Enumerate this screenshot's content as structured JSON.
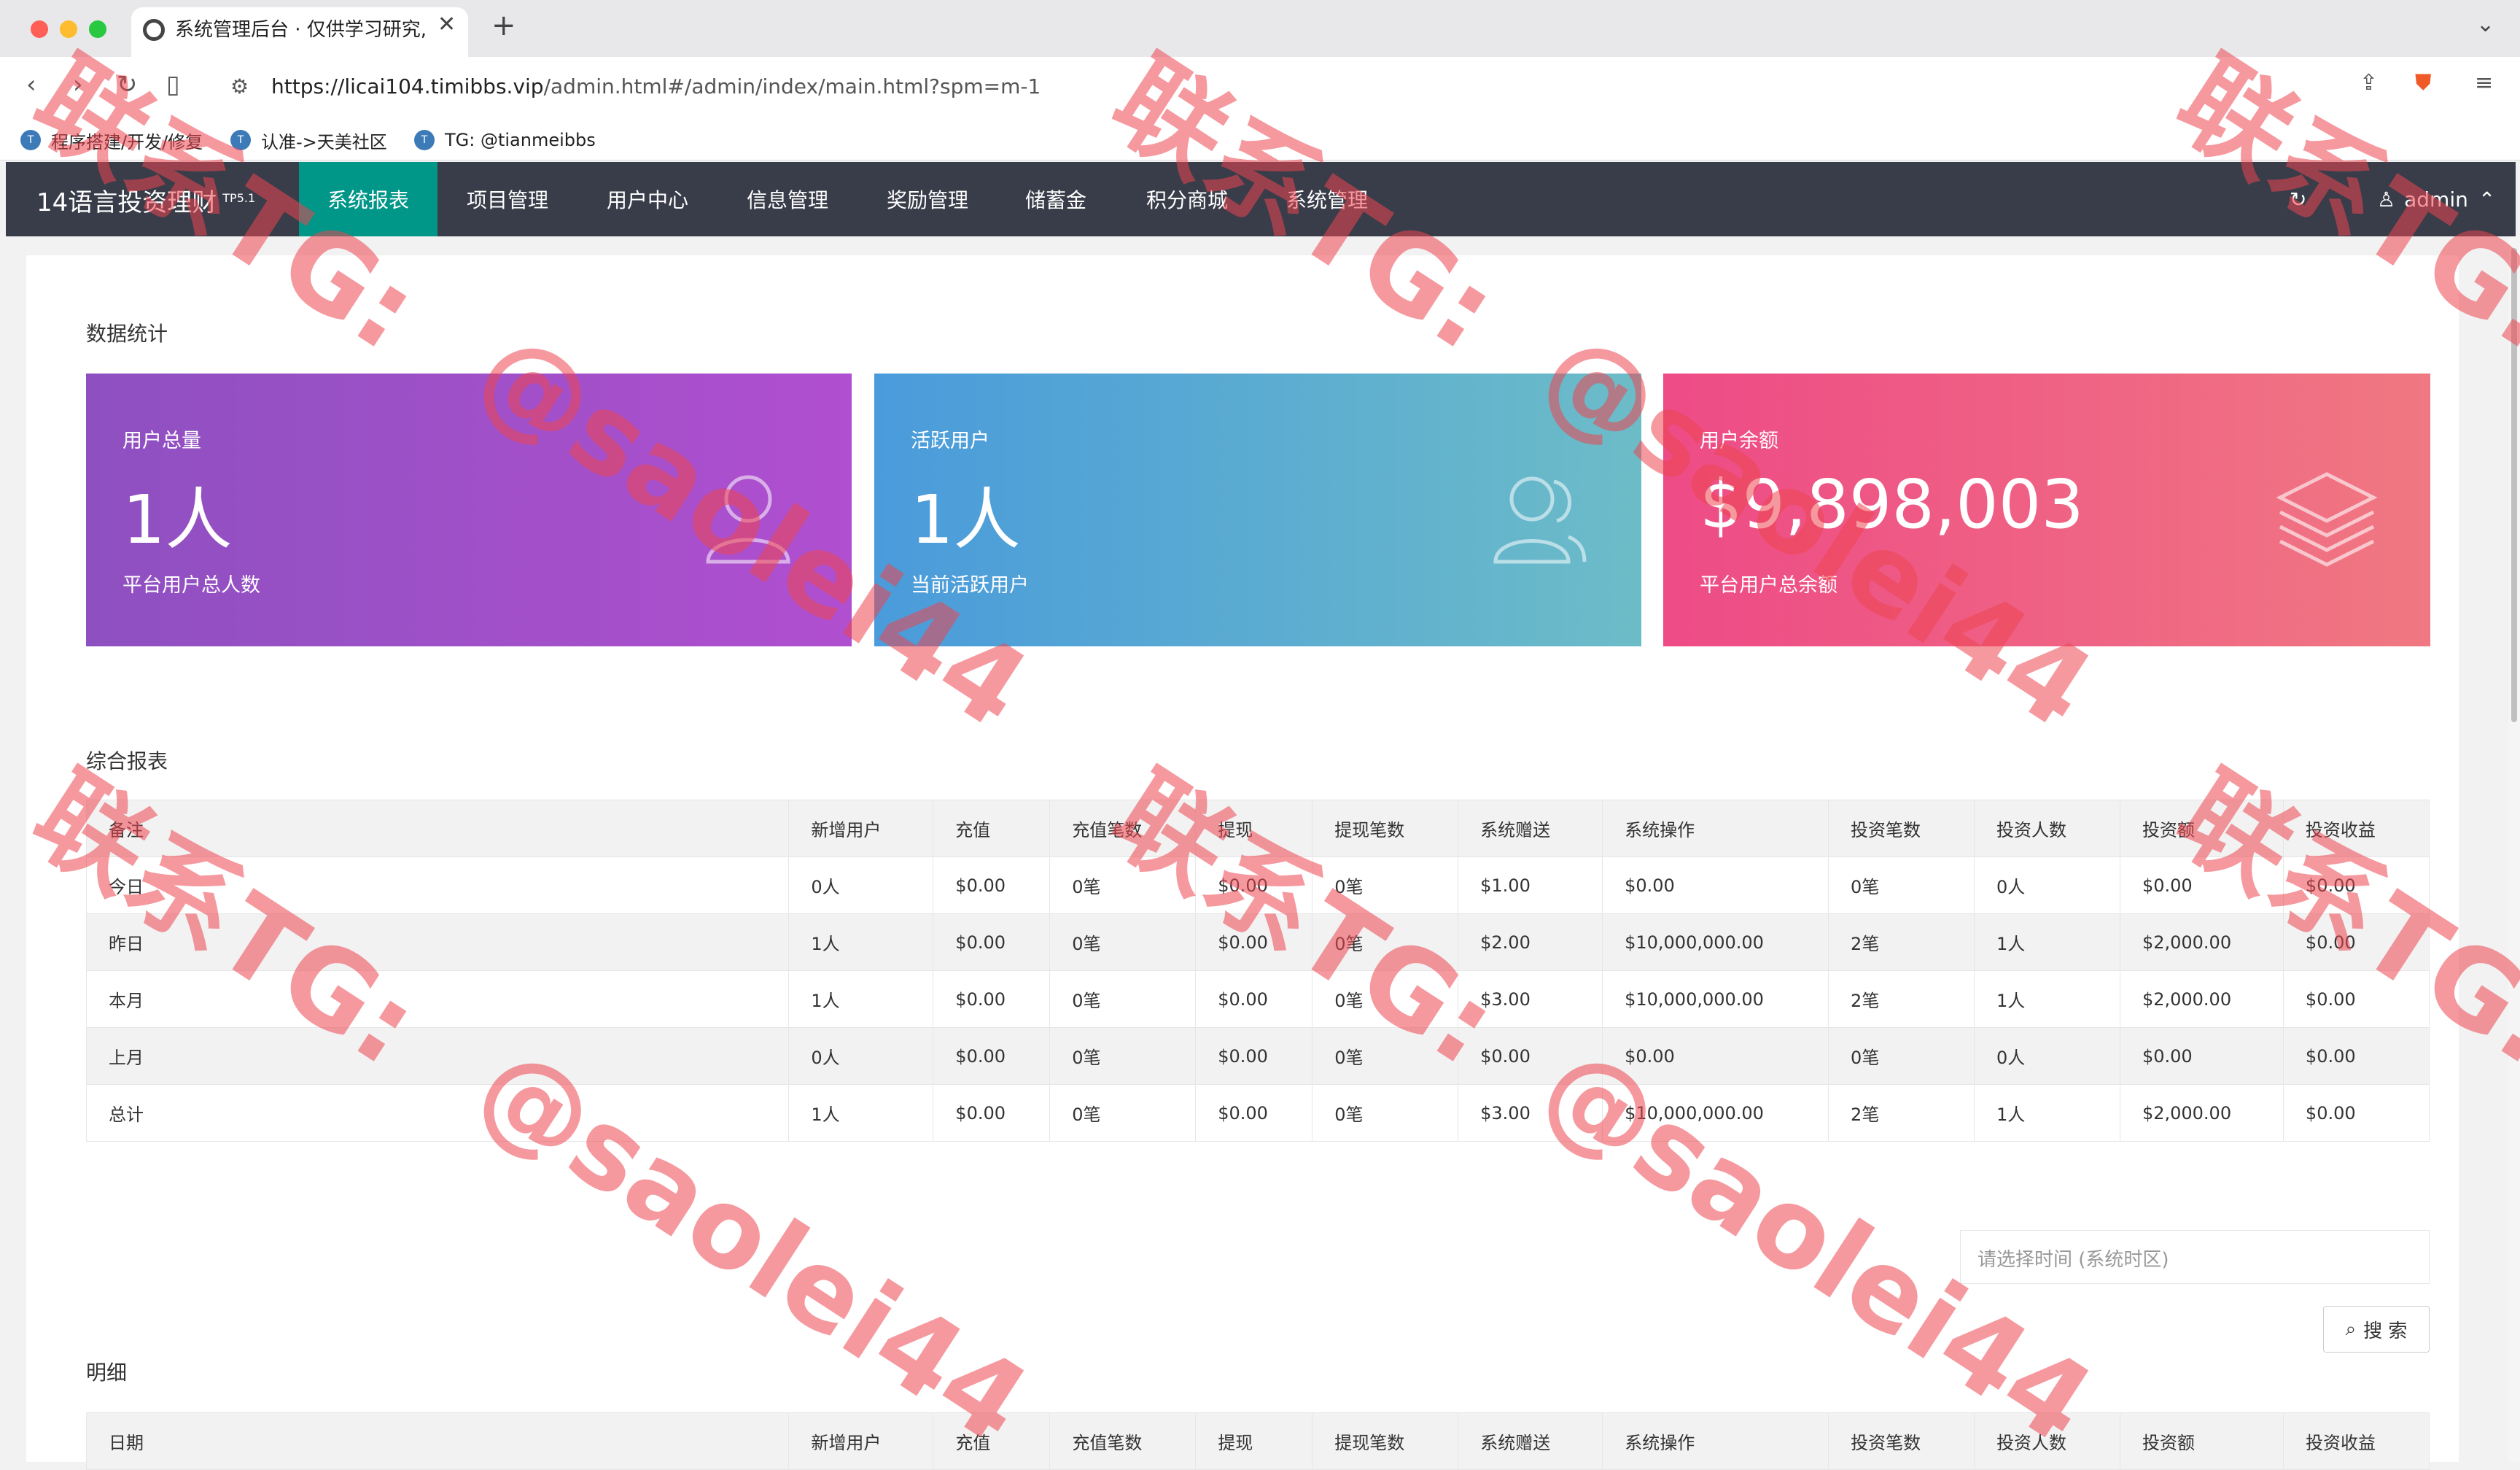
{
  "browser": {
    "tab_title": "系统管理后台 · 仅供学习研究,",
    "url_host": "https://licai104.timibbs.vip",
    "url_path": "/admin.html#/admin/index/main.html?spm=m-1",
    "bookmarks": [
      "程序搭建/开发/修复",
      "认准->天美社区",
      "TG: @tianmeibbs"
    ]
  },
  "app": {
    "logo": "14语言投资理财",
    "logo_sup": "TP5.1",
    "nav": [
      "系统报表",
      "项目管理",
      "用户中心",
      "信息管理",
      "奖励管理",
      "储蓄金",
      "积分商城",
      "系统管理"
    ],
    "active_nav": "系统报表",
    "user": "admin"
  },
  "stats": {
    "title": "数据统计",
    "cards": [
      {
        "label": "用户总量",
        "value": "1人",
        "desc": "平台用户总人数",
        "icon": "users-icon"
      },
      {
        "label": "活跃用户",
        "value": "1人",
        "desc": "当前活跃用户",
        "icon": "users-icon"
      },
      {
        "label": "用户余额",
        "value": "$9,898,003",
        "desc": "平台用户总余额",
        "icon": "layers-icon"
      }
    ]
  },
  "report": {
    "title": "综合报表",
    "headers": [
      "备注",
      "新增用户",
      "充值",
      "充值笔数",
      "提现",
      "提现笔数",
      "系统赠送",
      "系统操作",
      "投资笔数",
      "投资人数",
      "投资额",
      "投资收益"
    ],
    "rows": [
      [
        "今日",
        "0人",
        "$0.00",
        "0笔",
        "$0.00",
        "0笔",
        "$1.00",
        "$0.00",
        "0笔",
        "0人",
        "$0.00",
        "$0.00"
      ],
      [
        "昨日",
        "1人",
        "$0.00",
        "0笔",
        "$0.00",
        "0笔",
        "$2.00",
        "$10,000,000.00",
        "2笔",
        "1人",
        "$2,000.00",
        "$0.00"
      ],
      [
        "本月",
        "1人",
        "$0.00",
        "0笔",
        "$0.00",
        "0笔",
        "$3.00",
        "$10,000,000.00",
        "2笔",
        "1人",
        "$2,000.00",
        "$0.00"
      ],
      [
        "上月",
        "0人",
        "$0.00",
        "0笔",
        "$0.00",
        "0笔",
        "$0.00",
        "$0.00",
        "0笔",
        "0人",
        "$0.00",
        "$0.00"
      ],
      [
        "总计",
        "1人",
        "$0.00",
        "0笔",
        "$0.00",
        "0笔",
        "$3.00",
        "$10,000,000.00",
        "2笔",
        "1人",
        "$2,000.00",
        "$0.00"
      ]
    ]
  },
  "detail": {
    "title": "明细",
    "search_placeholder": "请选择时间 (系统时区)",
    "search_button": "搜 索",
    "headers": [
      "日期",
      "新增用户",
      "充值",
      "充值笔数",
      "提现",
      "提现笔数",
      "系统赠送",
      "系统操作",
      "投资笔数",
      "投资人数",
      "投资额",
      "投资收益"
    ]
  },
  "watermarks": {
    "contact": "联系TG:",
    "handle": "@saolei44"
  },
  "colors": {
    "nav_bg": "#393d49",
    "nav_active": "#009688",
    "card1": "#9b4fc8",
    "card2": "#5aa9d2",
    "card3": "#ef5d84",
    "watermark": "#ec4650"
  }
}
